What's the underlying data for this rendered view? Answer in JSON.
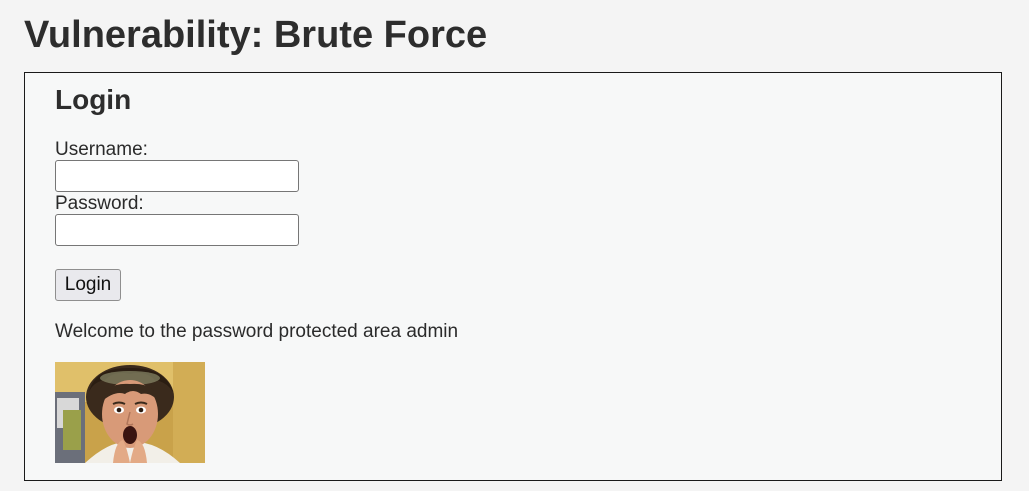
{
  "page": {
    "title": "Vulnerability: Brute Force"
  },
  "login": {
    "heading": "Login",
    "username_label": "Username:",
    "username_value": "",
    "password_label": "Password:",
    "password_value": "",
    "submit_label": "Login",
    "welcome_message": "Welcome to the password protected area admin"
  },
  "avatar": {
    "description_icon": "user-photo"
  },
  "colors": {
    "page_background": "#f4f4f4",
    "box_background": "#f7f8f8",
    "box_border": "#1a1a1a",
    "button_background": "#e9e9ed"
  }
}
